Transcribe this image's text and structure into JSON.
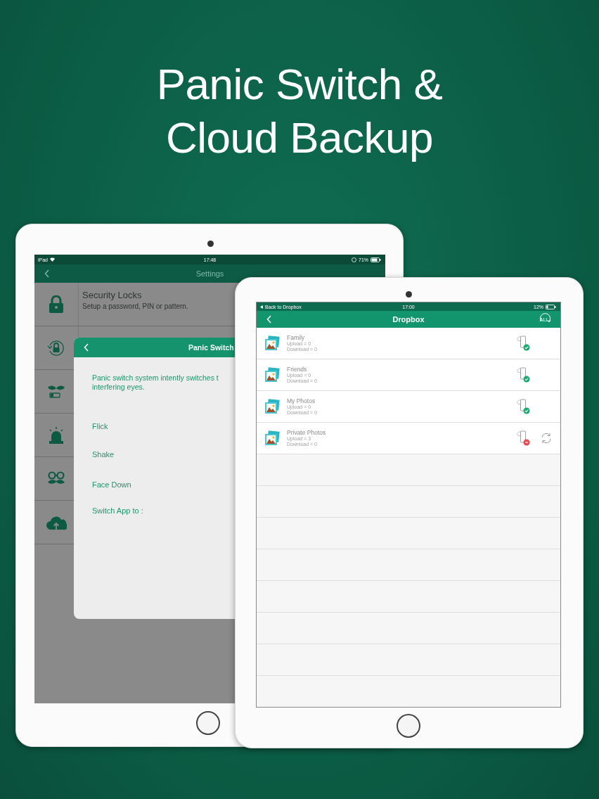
{
  "headline": [
    "Panic Switch &",
    "Cloud Backup"
  ],
  "settings_device": {
    "status_bar": {
      "device": "iPad",
      "time": "17:48",
      "battery": "71%"
    },
    "nav": {
      "title": "Settings"
    },
    "rows": [
      {
        "kind": "lock",
        "title": "Security Locks",
        "subtitle": "Setup a password, PIN or pattern."
      },
      {
        "kind": "recovery"
      },
      {
        "kind": "disguise"
      },
      {
        "kind": "alarm"
      },
      {
        "kind": "glasses"
      },
      {
        "kind": "cloud"
      }
    ],
    "dialog": {
      "title": "Panic Switch",
      "description": [
        "Panic switch system intently switches t",
        "interfering eyes."
      ],
      "options": [
        "Flick",
        "Shake",
        "Face Down"
      ],
      "switch_label": "Switch App to :"
    }
  },
  "dropbox_device": {
    "status_bar": {
      "back": "Back to Dropbox",
      "time": "17:00",
      "battery": "12%"
    },
    "nav": {
      "title": "Dropbox",
      "action": "ALL"
    },
    "folders": [
      {
        "name": "Family",
        "upload": "Upload = 0",
        "download": "Download = 0",
        "sync_error": false,
        "sync_button": false
      },
      {
        "name": "Friends",
        "upload": "Upload = 0",
        "download": "Download = 0",
        "sync_error": false,
        "sync_button": false
      },
      {
        "name": "My Photos",
        "upload": "Upload = 0",
        "download": "Download = 0",
        "sync_error": false,
        "sync_button": false
      },
      {
        "name": "Private Photos",
        "upload": "Upload = 3",
        "download": "Download = 0",
        "sync_error": true,
        "sync_button": true
      }
    ]
  }
}
